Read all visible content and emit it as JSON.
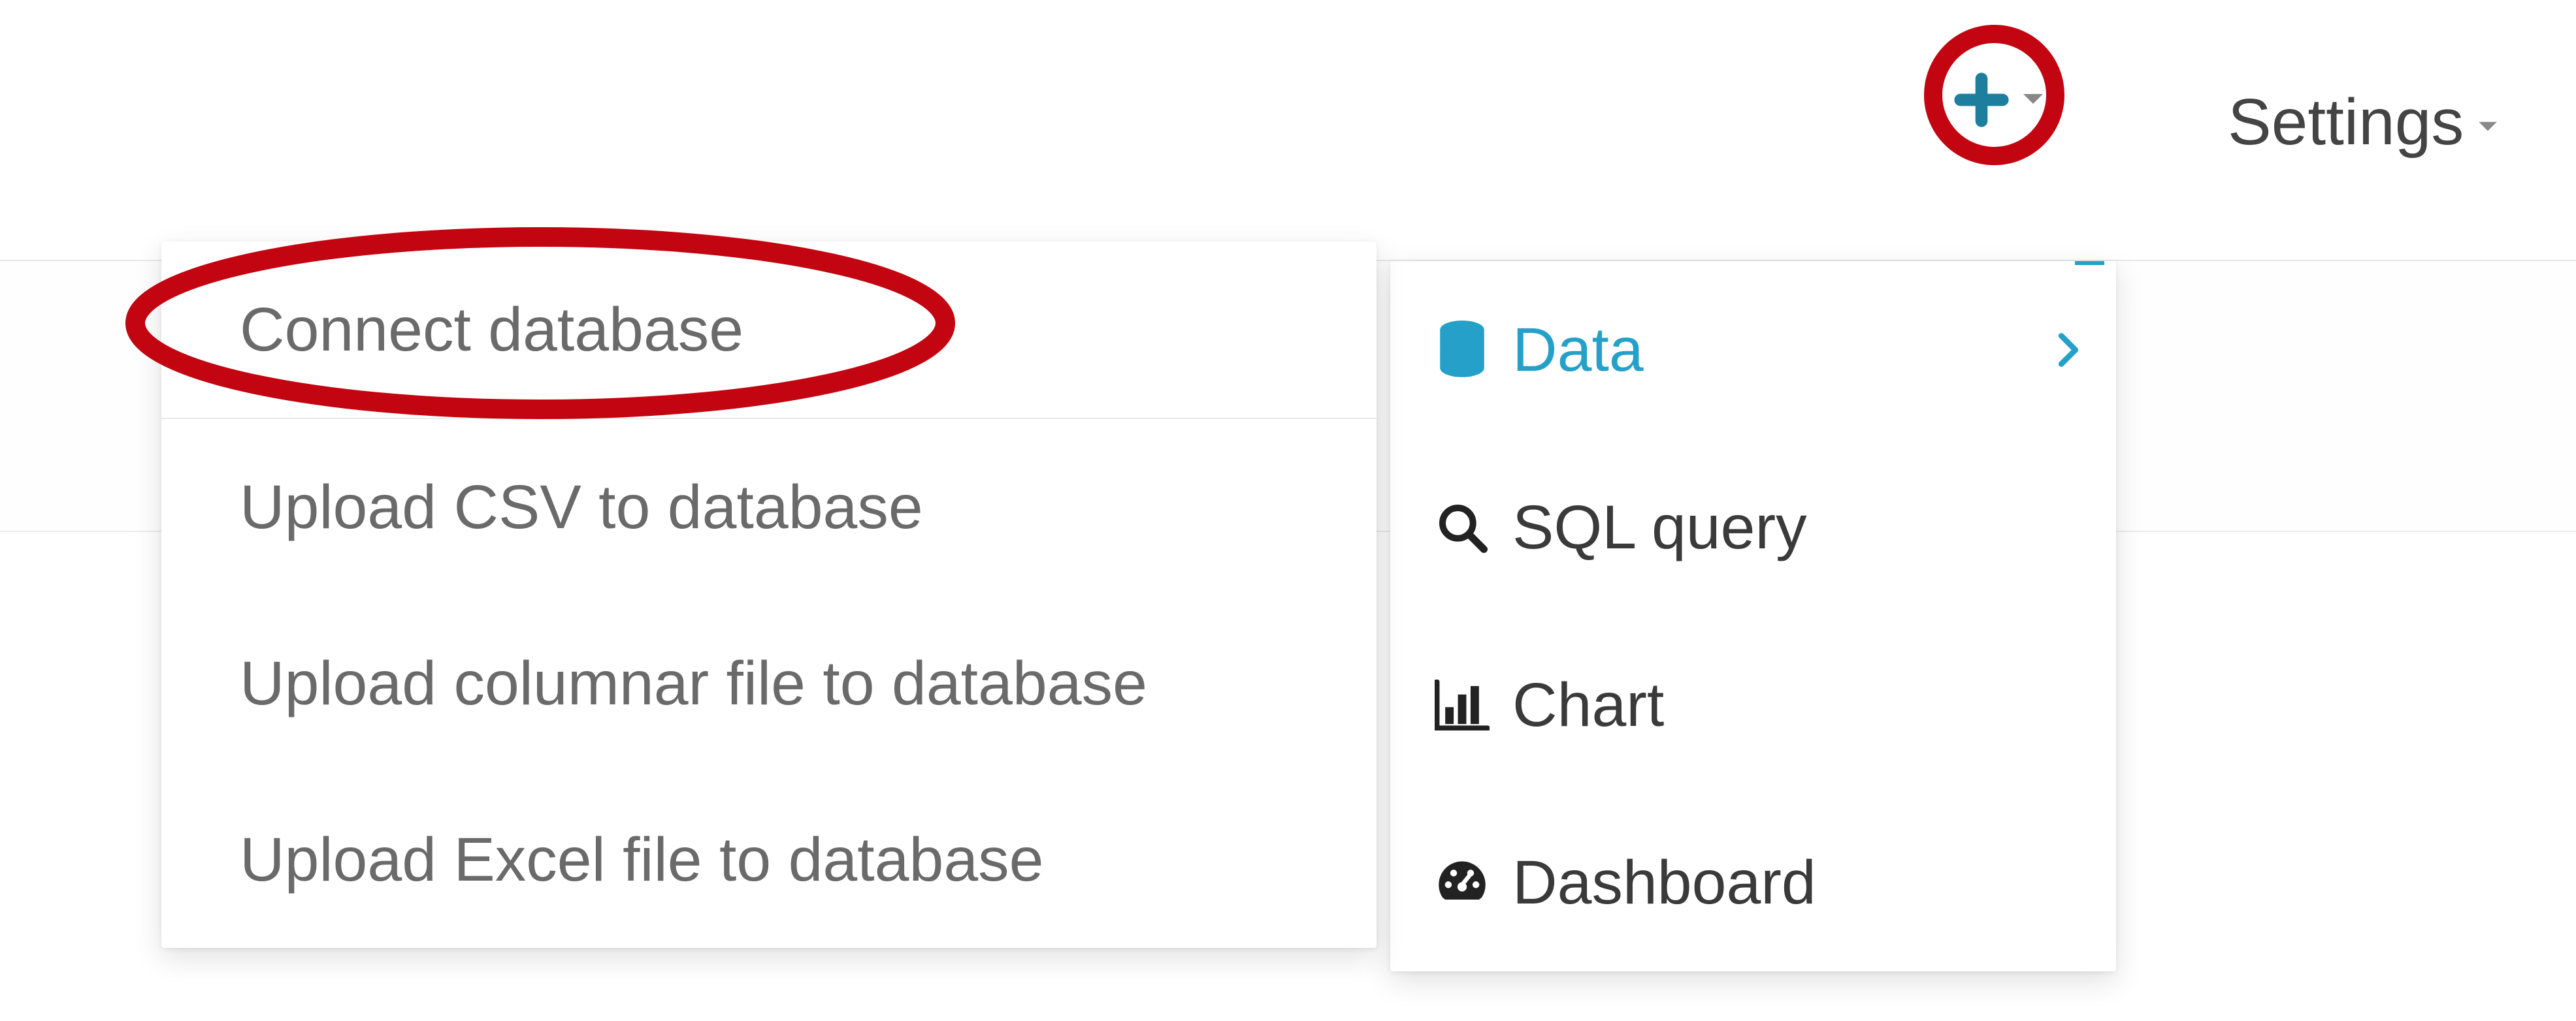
{
  "topbar": {
    "settings_label": "Settings"
  },
  "plus_menu": {
    "items": [
      {
        "label": "Data",
        "has_submenu": true,
        "active": true
      },
      {
        "label": "SQL query",
        "has_submenu": false
      },
      {
        "label": "Chart",
        "has_submenu": false
      },
      {
        "label": "Dashboard",
        "has_submenu": false
      }
    ]
  },
  "data_submenu": {
    "items": [
      {
        "label": "Connect database"
      },
      {
        "label": "Upload CSV to database"
      },
      {
        "label": "Upload columnar file to database"
      },
      {
        "label": "Upload Excel file to database"
      }
    ]
  },
  "annotations": {
    "highlight_plus": true,
    "highlight_connect_database": true
  },
  "colors": {
    "accent": "#25a0c8",
    "highlight_red": "#c20510",
    "text_primary": "#3a3a3a",
    "text_muted": "#6a6a6a"
  }
}
